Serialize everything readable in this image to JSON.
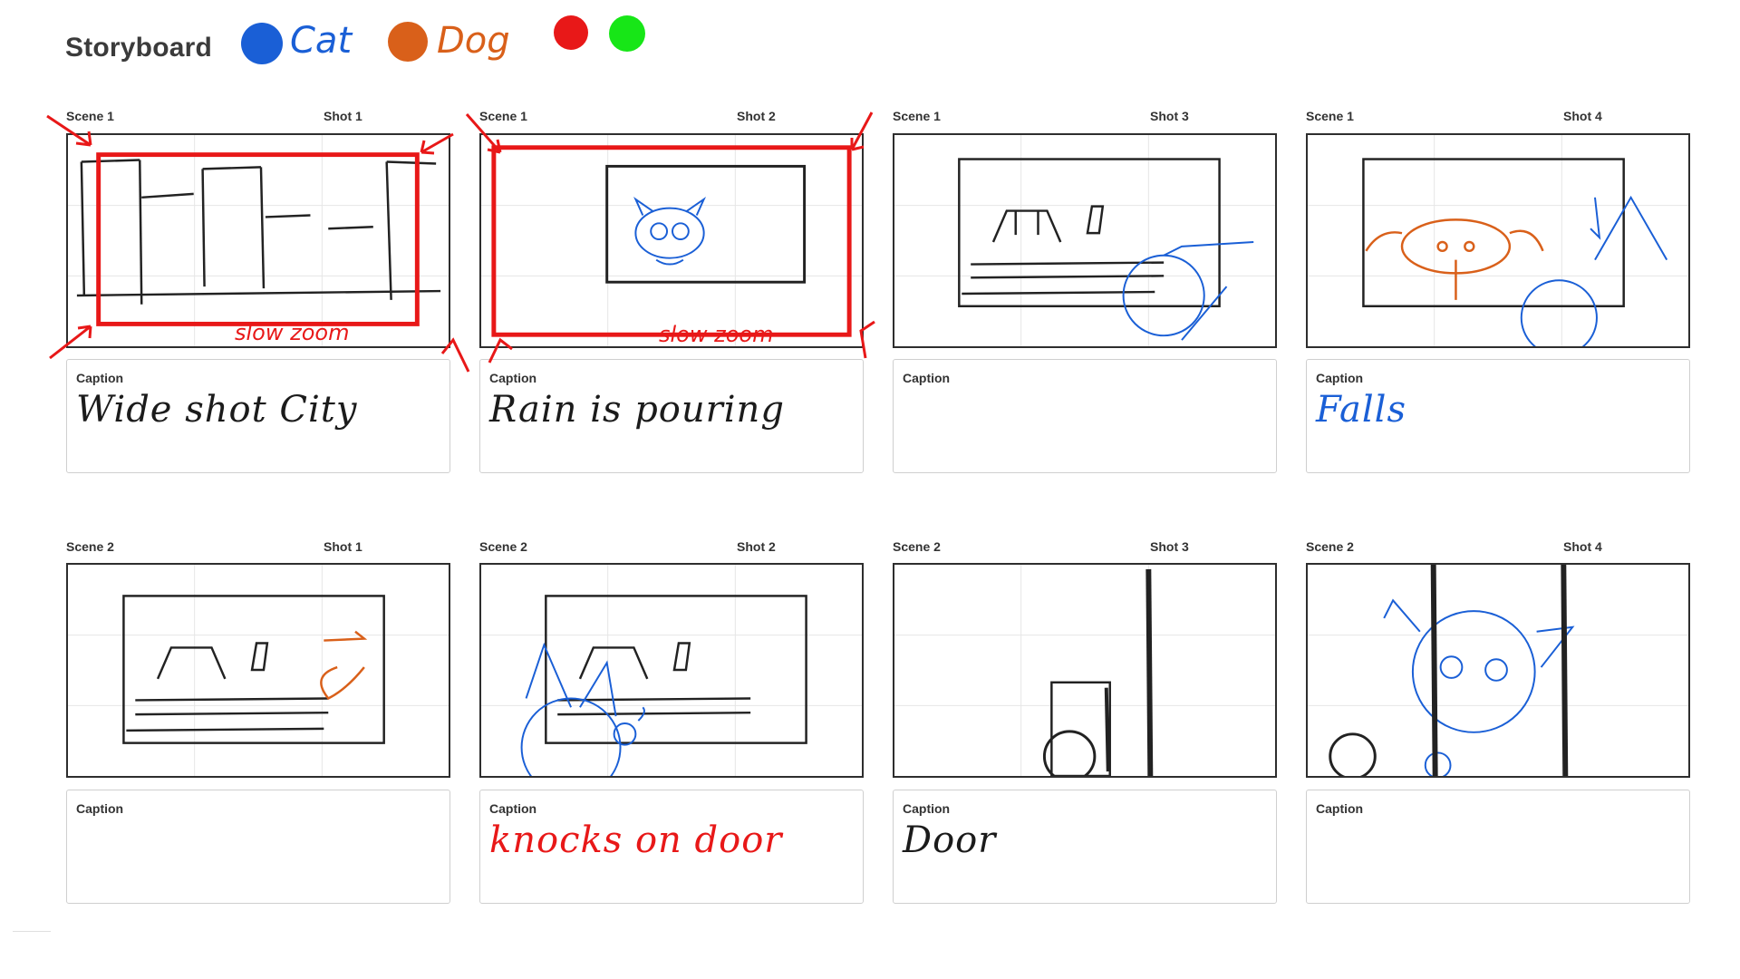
{
  "app": {
    "title": "Storyboard"
  },
  "legend": [
    {
      "color": "#1a5fd6",
      "label": "Cat"
    },
    {
      "color": "#d9601a",
      "label": "Dog"
    },
    {
      "color": "#e81818",
      "label": ""
    },
    {
      "color": "#17e617",
      "label": ""
    }
  ],
  "panels": [
    {
      "scene": "Scene 1",
      "shot": "Shot 1",
      "caption_label": "Caption",
      "caption_text": "Wide shot City",
      "caption_color": "#1b1b1b",
      "note": "slow zoom"
    },
    {
      "scene": "Scene 1",
      "shot": "Shot 2",
      "caption_label": "Caption",
      "caption_text": "Rain is pouring",
      "caption_color": "#1b1b1b",
      "note": "slow zoom"
    },
    {
      "scene": "Scene 1",
      "shot": "Shot 3",
      "caption_label": "Caption",
      "caption_text": "",
      "caption_color": "#1b1b1b",
      "note": ""
    },
    {
      "scene": "Scene 1",
      "shot": "Shot 4",
      "caption_label": "Caption",
      "caption_text": "Falls",
      "caption_color": "#1a5fd6",
      "note": ""
    },
    {
      "scene": "Scene 2",
      "shot": "Shot 1",
      "caption_label": "Caption",
      "caption_text": "",
      "caption_color": "#1b1b1b",
      "note": ""
    },
    {
      "scene": "Scene 2",
      "shot": "Shot 2",
      "caption_label": "Caption",
      "caption_text": "knocks on door",
      "caption_color": "#e81818",
      "note": ""
    },
    {
      "scene": "Scene 2",
      "shot": "Shot 3",
      "caption_label": "Caption",
      "caption_text": "Door",
      "caption_color": "#1b1b1b",
      "note": ""
    },
    {
      "scene": "Scene 2",
      "shot": "Shot 4",
      "caption_label": "Caption",
      "caption_text": "",
      "caption_color": "#1b1b1b",
      "note": ""
    }
  ]
}
